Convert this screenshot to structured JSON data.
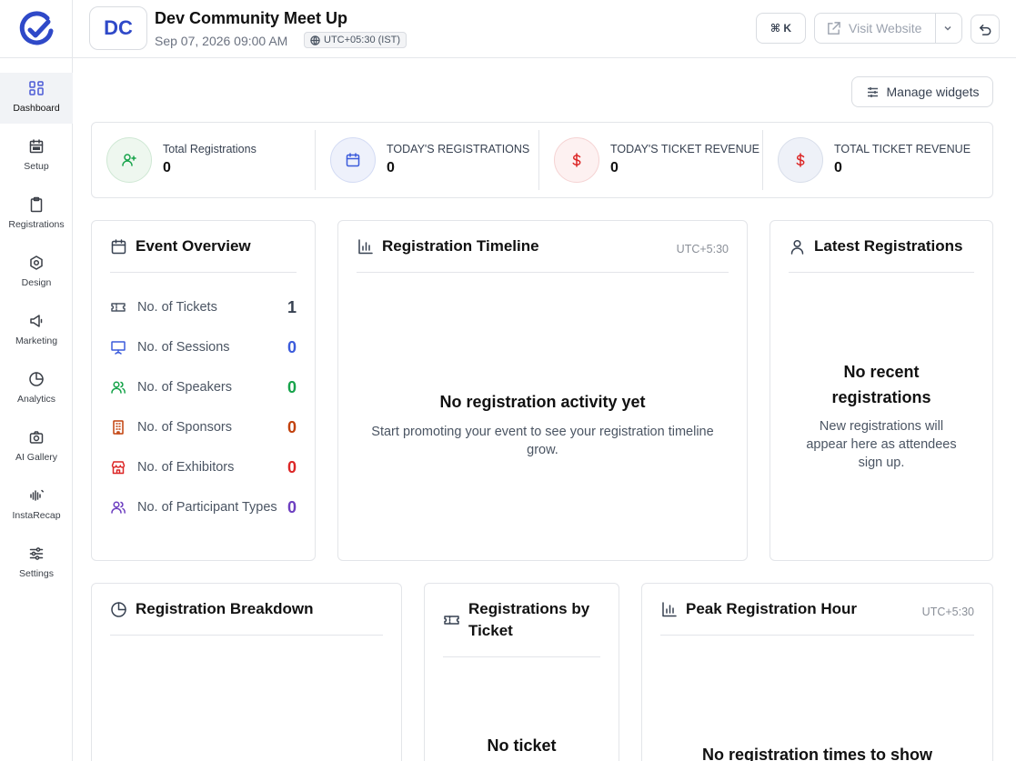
{
  "sidebar": {
    "items": [
      {
        "label": "Dashboard",
        "icon": "grid-icon",
        "active": true
      },
      {
        "label": "Setup",
        "icon": "calendar-icon"
      },
      {
        "label": "Registrations",
        "icon": "clipboard-icon"
      },
      {
        "label": "Design",
        "icon": "palette-icon"
      },
      {
        "label": "Marketing",
        "icon": "megaphone-icon"
      },
      {
        "label": "Analytics",
        "icon": "pie-chart-icon"
      },
      {
        "label": "AI Gallery",
        "icon": "camera-icon"
      },
      {
        "label": "InstaRecap",
        "icon": "soundwave-icon"
      },
      {
        "label": "Settings",
        "icon": "sliders-icon"
      }
    ]
  },
  "header": {
    "initials": "DC",
    "event_title": "Dev Community Meet Up",
    "event_date": "Sep 07, 2026 09:00 AM",
    "timezone": "UTC+05:30 (IST)",
    "shortcut": "⌘ K",
    "visit_label": "Visit Website"
  },
  "toolbar": {
    "manage_label": "Manage widgets"
  },
  "stats": [
    {
      "label": "Total Registrations",
      "value": "0",
      "icon": "user-plus-icon",
      "color": "#16a34a"
    },
    {
      "label": "TODAY'S REGISTRATIONS",
      "value": "0",
      "icon": "calendar-icon",
      "color": "#3b5bdb"
    },
    {
      "label": "TODAY'S TICKET REVENUE",
      "value": "0",
      "icon": "dollar-icon",
      "color": "#dc2626"
    },
    {
      "label": "TOTAL TICKET REVENUE",
      "value": "0",
      "icon": "dollar-icon",
      "color": "#dc2626"
    }
  ],
  "event_overview": {
    "title": "Event Overview",
    "rows": [
      {
        "label": "No. of Tickets",
        "value": "1",
        "color": "#374151",
        "icon": "ticket-icon"
      },
      {
        "label": "No. of Sessions",
        "value": "0",
        "color": "#3b5bdb",
        "icon": "presentation-icon"
      },
      {
        "label": "No. of Speakers",
        "value": "0",
        "color": "#16a34a",
        "icon": "users-icon"
      },
      {
        "label": "No. of Sponsors",
        "value": "0",
        "color": "#c2410c",
        "icon": "building-icon"
      },
      {
        "label": "No. of Exhibitors",
        "value": "0",
        "color": "#dc2626",
        "icon": "store-icon"
      },
      {
        "label": "No. of Participant Types",
        "value": "0",
        "color": "#6d3fc0",
        "icon": "users-icon"
      }
    ]
  },
  "timeline": {
    "title": "Registration Timeline",
    "tz": "UTC+5:30",
    "empty_title": "No registration activity yet",
    "empty_sub": "Start promoting your event to see your registration timeline grow."
  },
  "latest": {
    "title": "Latest Registrations",
    "empty_title": "No recent registrations",
    "empty_sub": "New registrations will appear here as attendees sign up."
  },
  "breakdown": {
    "title": "Registration Breakdown"
  },
  "by_ticket": {
    "title": "Registrations by Ticket",
    "empty_title": "No ticket"
  },
  "peak": {
    "title": "Peak Registration Hour",
    "tz": "UTC+5:30",
    "empty_title": "No registration times to show"
  }
}
